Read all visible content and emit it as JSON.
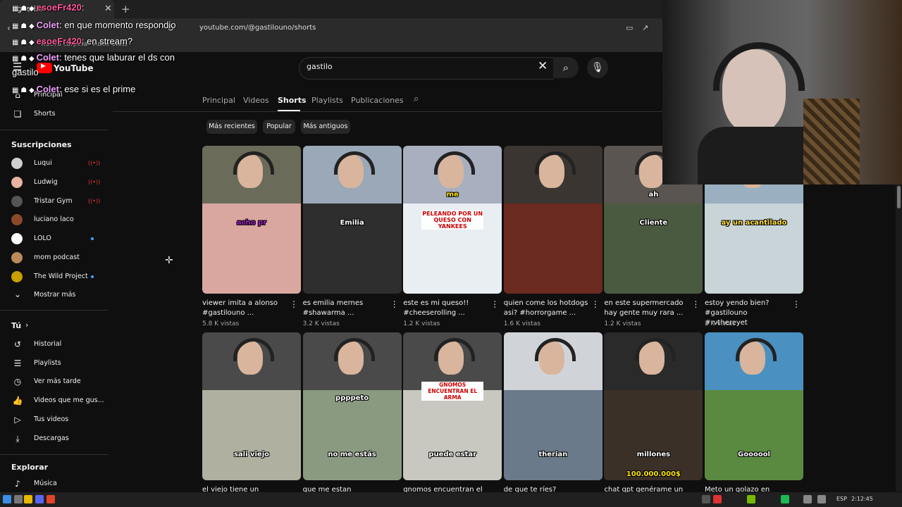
{
  "browser": {
    "tab_title": "gastilo",
    "url": "youtube.com/@gastilouno/shorts",
    "bookmarks": [
      "Nueva carpeta",
      "Video Stats"
    ],
    "new_tab_glyph": "+"
  },
  "youtube": {
    "logo_text": "YouTube",
    "search_value": "gastilo",
    "channel_tabs": [
      "Principal",
      "Videos",
      "Shorts",
      "Playlists",
      "Publicaciones"
    ],
    "active_tab": "Shorts",
    "filter_chips": [
      "Más recientes",
      "Popular",
      "Más antiguos"
    ]
  },
  "sidebar": {
    "top_items": [
      {
        "label": "Principal",
        "icon": "home-icon"
      },
      {
        "label": "Shorts",
        "icon": "shorts-icon"
      }
    ],
    "subscriptions_header": "Suscripciones",
    "subscriptions": [
      {
        "label": "Luqui",
        "status": "live",
        "color": "#cfcfcf"
      },
      {
        "label": "Ludwig",
        "status": "live",
        "color": "#e6b4a0"
      },
      {
        "label": "Tristar Gym",
        "status": "live",
        "color": "#555555"
      },
      {
        "label": "luciano laco",
        "status": "",
        "color": "#8a4a2a"
      },
      {
        "label": "LOLO",
        "status": "new",
        "color": "#ffffff"
      },
      {
        "label": "mom podcast",
        "status": "",
        "color": "#b98b5a"
      },
      {
        "label": "The Wild Project",
        "status": "new",
        "color": "#c8a000"
      }
    ],
    "show_more": "Mostrar más",
    "you_header": "Tú",
    "you_items": [
      {
        "label": "Historial",
        "icon": "history-icon"
      },
      {
        "label": "Playlists",
        "icon": "playlists-icon"
      },
      {
        "label": "Ver más tarde",
        "icon": "watch-later-icon"
      },
      {
        "label": "Videos que me gus...",
        "icon": "like-icon"
      },
      {
        "label": "Tus videos",
        "icon": "your-videos-icon"
      },
      {
        "label": "Descargas",
        "icon": "download-icon"
      }
    ],
    "explore_header": "Explorar",
    "explore_items": [
      {
        "label": "Música",
        "icon": "music-icon"
      }
    ]
  },
  "shorts": [
    {
      "title": "viewer imita a alonso #gastilouno ...",
      "views": "5.8 K vistas",
      "caption": "acho pr",
      "top": "#6b6b5a",
      "bottom": "#d9a7a0"
    },
    {
      "title": "es emilia mernes #shawarma ...",
      "views": "3.2 K vistas",
      "caption": "Emilia",
      "top": "#9aa8b8",
      "bottom": "#2e2e2e"
    },
    {
      "title": "este es mi queso!! #cheeserolling ...",
      "views": "1.2 K vistas",
      "caption": "PELEANDO POR UN QUESO CON YANKEES",
      "top": "#a8b0c0",
      "bottom": "#e8eef2"
    },
    {
      "title": "quien come los hotdogs asi? #horrorgame ...",
      "views": "1.6 K vistas",
      "caption": "",
      "top": "#3a3530",
      "bottom": "#6a2a20"
    },
    {
      "title": "en este supermercado hay gente muy rara ...",
      "views": "1.2 K vistas",
      "caption": "Cliente",
      "top": "#5a5550",
      "bottom": "#4a5a40"
    },
    {
      "title": "estoy yendo bien? #gastilouno #rvthereyet",
      "views": "2 K vistas",
      "caption": "ay un acantilado",
      "top": "#9ab0c0",
      "bottom": "#c8d4d8"
    },
    {
      "title": "el viejo tiene un",
      "views": "",
      "caption": "sali viejo",
      "top": "#4a4a4a",
      "bottom": "#b0b0a0"
    },
    {
      "title": "que me estan",
      "views": "",
      "caption": "no me estás",
      "top": "#4a4a4a",
      "bottom": "#8a9a80"
    },
    {
      "title": "gnomos encuentran el",
      "views": "",
      "caption": "puede estar",
      "top": "#4a4a4a",
      "bottom": "#c8c8c0"
    },
    {
      "title": "de que te ríes? #therian",
      "views": "",
      "caption": "therian",
      "top": "#d0d4d8",
      "bottom": "#6a7a8a"
    },
    {
      "title": "chat gpt genérame un",
      "views": "",
      "caption": "millones",
      "top": "#2a2a2a",
      "bottom": "#3a3028"
    },
    {
      "title": "Meto un golazo en",
      "views": "",
      "caption": "Goooool",
      "top": "#4a90c0",
      "bottom": "#5a8a40"
    }
  ],
  "shorts_extra_text": {
    "row1_sub": [
      "",
      "",
      "me",
      "",
      "ah",
      ""
    ],
    "row2_sub": [
      "",
      "ppppeto",
      "GNOMOS ENCUENTRAN EL ARMA",
      "",
      "100.000.000$",
      ""
    ]
  },
  "chat_overlay": [
    {
      "user": "esoeFr420",
      "text": ""
    },
    {
      "user": "Colet",
      "text": "en que momento respondio"
    },
    {
      "user": "esoeFr420",
      "text": "en stream?"
    },
    {
      "user": "Colet",
      "text": "tenes que laburar el ds con"
    },
    {
      "user": "",
      "text": "gastilo"
    },
    {
      "user": "Colet",
      "text": "ese si es el prime"
    }
  ],
  "taskbar": {
    "lang": "ESP",
    "time": "2:12:45"
  }
}
